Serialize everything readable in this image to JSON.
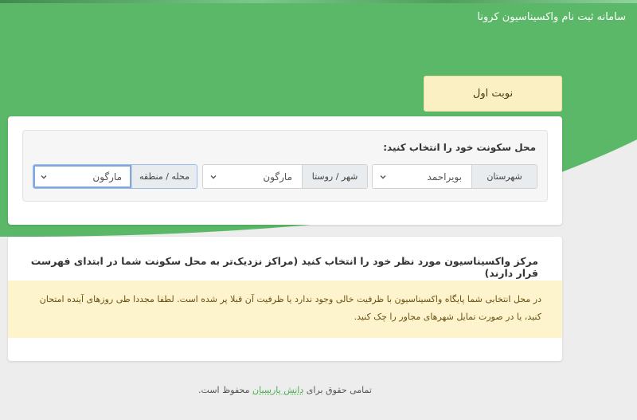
{
  "app": {
    "title": "سامانه ثبت نام واکسیناسیون کرونا"
  },
  "tab": {
    "label": "نوبت اول"
  },
  "location": {
    "label": "محل سکونت خود را انتخاب کنید:",
    "fields": [
      {
        "label": "شهرستان",
        "value": "بویراحمد"
      },
      {
        "label": "شهر / روستا",
        "value": "مارگون"
      },
      {
        "label": "محله / منطقه",
        "value": "مارگون"
      }
    ]
  },
  "center": {
    "title": "مرکز واکسیناسیون مورد نظر خود را انتخاب کنید (مراکز نزدیک‌تر به محل سکونت شما در ابتدای فهرست قرار دارند)",
    "alert": "در محل انتخابی شما پایگاه واکسیناسیون با ظرفیت خالی وجود ندارد یا ظرفیت آن قبلا پر شده است. لطفا مجددا طی روزهای آینده امتحان کنید، یا در صورت تمایل شهرهای مجاور را چک کنید."
  },
  "footer": {
    "prefix": "تمامی حقوق برای",
    "link": "دانش پارسیان",
    "suffix": "محفوظ است."
  },
  "colors": {
    "brand_green": "#5bb868",
    "badge_bg": "#fbefc4",
    "alert_bg": "#fdf3cd",
    "link": "#4caf50"
  }
}
